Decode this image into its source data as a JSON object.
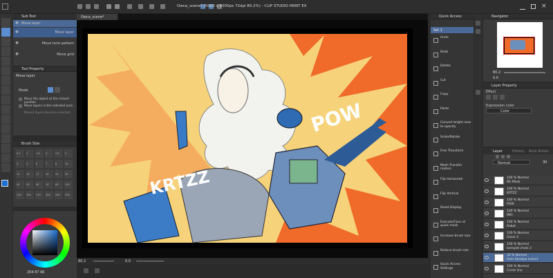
{
  "title_bar": {
    "doc_title": "Owca_scene* (5000 x 5000px 72dpi 80.2%) - CLIP STUDIO PAINT EX"
  },
  "canvas_tab": {
    "label": "Owca_scene*"
  },
  "sub_tool": {
    "header": "Sub Tool",
    "items": [
      {
        "label": "Move layer"
      },
      {
        "label": "Move layer"
      },
      {
        "label": "Move tone pattern"
      },
      {
        "label": "Move grid"
      }
    ]
  },
  "tool_property": {
    "header": "Tool Property",
    "tool_name": "Move layer",
    "mode_label": "Mode",
    "options": [
      "Move the object at the clicked position",
      "Move layers in the selected area",
      "Moved layers become selected"
    ]
  },
  "brush_size": {
    "header": "Brush Size",
    "values": [
      "0.7",
      "1",
      "1.5",
      "2",
      "2.5",
      "3",
      "4",
      "5",
      "6",
      "7",
      "8",
      "10",
      "12",
      "15",
      "17",
      "20",
      "25",
      "30",
      "40",
      "50",
      "60",
      "70",
      "80",
      "100",
      "120",
      "150",
      "170",
      "200",
      "250",
      "300"
    ]
  },
  "color": {
    "readout": "204  87  66",
    "accent": "#1a6fd1"
  },
  "quick_access": {
    "header": "Quick Access",
    "set_label": "Set 1",
    "items": [
      {
        "label": "Undo"
      },
      {
        "label": "Redo"
      },
      {
        "label": "Delete"
      },
      {
        "label": "Cut"
      },
      {
        "label": "Copy"
      },
      {
        "label": "Paste"
      },
      {
        "label": "Convert bright ness to opacity"
      },
      {
        "label": "Scale/Rotate"
      },
      {
        "label": "Free Transform"
      },
      {
        "label": "Mesh Transfor mation"
      },
      {
        "label": "Flip Horizontal"
      },
      {
        "label": "Flip Vertical"
      },
      {
        "label": "Reset Display"
      },
      {
        "label": "Execute/Canc el quick mask"
      },
      {
        "label": "Increase brush size"
      },
      {
        "label": "Reduce brush size"
      },
      {
        "label": "Quick Access Settings"
      }
    ]
  },
  "navigator": {
    "header": "Navigator",
    "zoom": "80.2",
    "rotation": "0.0"
  },
  "layer_property": {
    "header": "Layer Property",
    "effect": "Effect",
    "expression_color_label": "Expression color",
    "expression_color_value": "Color"
  },
  "layer_panel": {
    "tabs": [
      "Layer",
      "History",
      "Auto Action"
    ],
    "blend_mode": "Normal",
    "opacity": "30",
    "layers": [
      {
        "pct": "100 %",
        "mode": "Normal",
        "name": "BG Mask"
      },
      {
        "pct": "100 %",
        "mode": "Normal",
        "name": "KRTZZ"
      },
      {
        "pct": "100 %",
        "mode": "Normal",
        "name": "POW"
      },
      {
        "pct": "100 %",
        "mode": "Normal",
        "name": "IMG"
      },
      {
        "pct": "100 %",
        "mode": "Normal",
        "name": "Robot"
      },
      {
        "pct": "100 %",
        "mode": "Normal",
        "name": "Glove 2"
      },
      {
        "pct": "100 %",
        "mode": "Normal",
        "name": "komplot chole 2"
      },
      {
        "pct": "30 %",
        "mode": "Normal",
        "name": "Ram Shadow Instert"
      },
      {
        "pct": "100 %",
        "mode": "Normal",
        "name": "Cristo line"
      }
    ]
  },
  "canvas_text": {
    "krtzz": "KRTZZ",
    "pow": "POW"
  },
  "status_bar": {
    "zoom": "80.2",
    "coords": "0.0"
  }
}
